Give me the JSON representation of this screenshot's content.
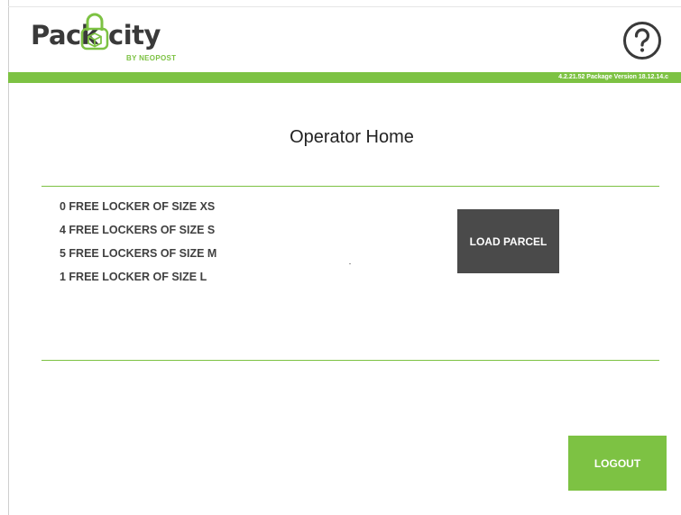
{
  "header": {
    "logo": {
      "word_left": "Pack",
      "word_right": "city",
      "tagline": "BY NEOPOST"
    },
    "help_icon": "help-question-icon",
    "version_text": "4.2.21.52  Package Version  18.12.14.c"
  },
  "page": {
    "title": "Operator Home"
  },
  "lockers": {
    "items": [
      "0 FREE LOCKER OF SIZE XS",
      "4 FREE LOCKERS OF SIZE S",
      "5 FREE LOCKERS OF SIZE M",
      "1 FREE LOCKER OF SIZE L"
    ]
  },
  "actions": {
    "load_parcel_label": "LOAD PARCEL",
    "logout_label": "LOGOUT"
  },
  "colors": {
    "brand_green": "#7dc243",
    "dark_button": "#4a4a4a",
    "text_dark": "#404040"
  }
}
